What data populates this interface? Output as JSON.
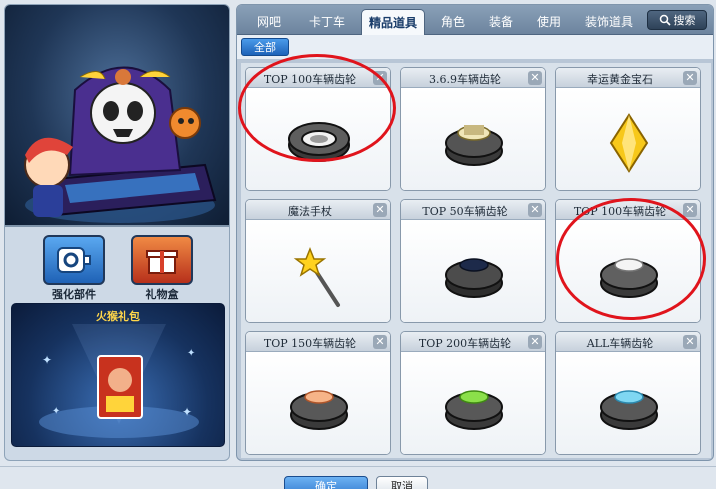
{
  "left_panel": {
    "parts_label": "强化部件",
    "gift_label": "礼物盒",
    "gift_pack_title": "火猴礼包"
  },
  "tabs": [
    {
      "label": "网吧",
      "active": false
    },
    {
      "label": "卡丁车",
      "active": false
    },
    {
      "label": "精品道具",
      "active": true
    },
    {
      "label": "角色",
      "active": false
    },
    {
      "label": "装备",
      "active": false
    },
    {
      "label": "使用",
      "active": false
    },
    {
      "label": "装饰道具",
      "active": false
    }
  ],
  "search_label": "搜索",
  "subtab_label": "全部",
  "items": [
    {
      "title": "TOP  100车辆齿轮",
      "icon": "gear-black-icon",
      "close": "✕"
    },
    {
      "title": "3.6.9车辆齿轮",
      "icon": "gear-369-icon",
      "close": "✕"
    },
    {
      "title": "幸运黄金宝石",
      "icon": "gold-gem-icon",
      "close": "✕"
    },
    {
      "title": "魔法手杖",
      "icon": "magic-wand-icon",
      "close": "✕"
    },
    {
      "title": "TOP 50车辆齿轮",
      "icon": "gear-dark-icon",
      "close": "✕"
    },
    {
      "title": "TOP 100车辆齿轮",
      "icon": "gear-silver-icon",
      "close": "✕"
    },
    {
      "title": "TOP 150车辆齿轮",
      "icon": "gear-orange-icon",
      "close": "✕"
    },
    {
      "title": "TOP 200车辆齿轮",
      "icon": "gear-green-icon",
      "close": "✕"
    },
    {
      "title": "ALL车辆齿轮",
      "icon": "gear-blue-icon",
      "close": "✕"
    }
  ],
  "bottom": {
    "confirm_label": "确定",
    "cancel_label": "取消"
  },
  "colors": {
    "annotation": "#e0141c",
    "active_tab_text": "#1a3d6a",
    "gift_title": "#ffd64a"
  }
}
